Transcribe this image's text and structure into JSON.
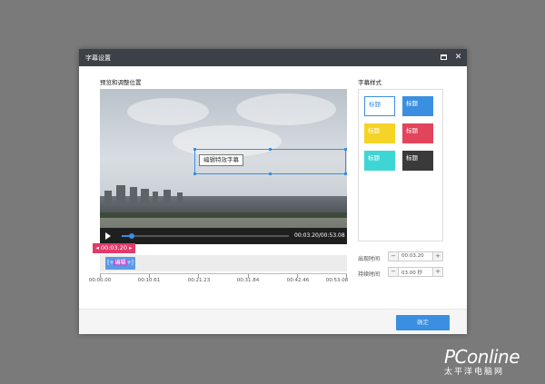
{
  "dialog": {
    "title": "字幕设置",
    "maximize_icon": "maximize-icon",
    "close_icon": "close-icon",
    "close_glyph": "✕"
  },
  "preview": {
    "label": "预览和调整位置",
    "subtitle_text": "编辑特效字幕",
    "current_time": "00:03.20",
    "total_time": "00:53.08",
    "time_display": "00:03.20/00:53.08",
    "progress": 0.06
  },
  "timeline": {
    "marker_time": "00:03.20",
    "clip_label": "编辑",
    "ticks": [
      "00:00.00",
      "00:10.61",
      "00:21.23",
      "00:31.84",
      "00:42.46",
      "00:53.08"
    ]
  },
  "styles": {
    "label": "字幕样式",
    "items": [
      {
        "label": "标题",
        "bg": "#ffffff",
        "fg": "#3b8fe0",
        "selected": true
      },
      {
        "label": "标题",
        "bg": "#3b8fe0",
        "fg": "#ffffff",
        "selected": false
      },
      {
        "label": "标题",
        "bg": "#f5d327",
        "fg": "#ffffff",
        "selected": false
      },
      {
        "label": "标题",
        "bg": "#e2445c",
        "fg": "#ffffff",
        "selected": false
      },
      {
        "label": "标题",
        "bg": "#3ed6d4",
        "fg": "#ffffff",
        "selected": false
      },
      {
        "label": "标题",
        "bg": "#3a3a3a",
        "fg": "#ffffff",
        "selected": false
      }
    ]
  },
  "timing": {
    "appear_label": "出现时间",
    "appear_value": "00:03.20",
    "duration_label": "持续时间",
    "duration_value": "03.00 秒"
  },
  "footer": {
    "ok_label": "确定"
  },
  "watermark": {
    "brand": "PConline",
    "sub": "太平洋电脑网"
  },
  "colors": {
    "accent": "#3b8fe0",
    "marker": "#e23a6b",
    "titlebar": "#3c4047"
  }
}
